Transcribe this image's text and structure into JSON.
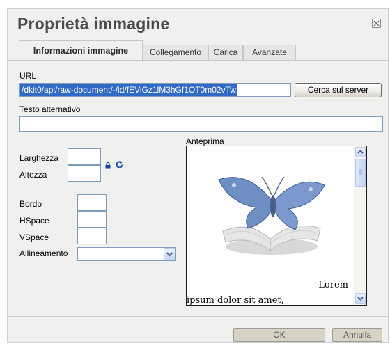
{
  "dialog": {
    "title": "Proprietà immagine",
    "close_icon": "close-icon"
  },
  "tabs": [
    {
      "label": "Informazioni immagine",
      "active": true
    },
    {
      "label": "Collegamento",
      "active": false
    },
    {
      "label": "Carica",
      "active": false
    },
    {
      "label": "Avanzate",
      "active": false
    }
  ],
  "url": {
    "label": "URL",
    "value": "/dkit0/api/raw-document/-/id/fEViGz1lM3hGf1OT0m02vTw",
    "browse_button": "Cerca sul server"
  },
  "alt_text": {
    "label": "Testo alternativo",
    "value": ""
  },
  "dimensions": {
    "width_label": "Larghezza",
    "height_label": "Altezza",
    "width_value": "",
    "height_value": "",
    "lock_icon": "lock-icon",
    "reset_icon": "reset-size-icon"
  },
  "spacing": {
    "border_label": "Bordo",
    "hspace_label": "HSpace",
    "vspace_label": "VSpace",
    "align_label": "Allineamento",
    "align_value": ""
  },
  "preview": {
    "label": "Anteprima",
    "image_icon": "butterfly-book-image",
    "text_line1": "Lorem",
    "text_line2": "ipsum dolor sit amet,"
  },
  "footer": {
    "ok": "OK",
    "cancel": "Annulla"
  },
  "colors": {
    "selection": "#316ac5",
    "input_border": "#7f9db9",
    "dialog_bg": "#f0f0ee"
  }
}
